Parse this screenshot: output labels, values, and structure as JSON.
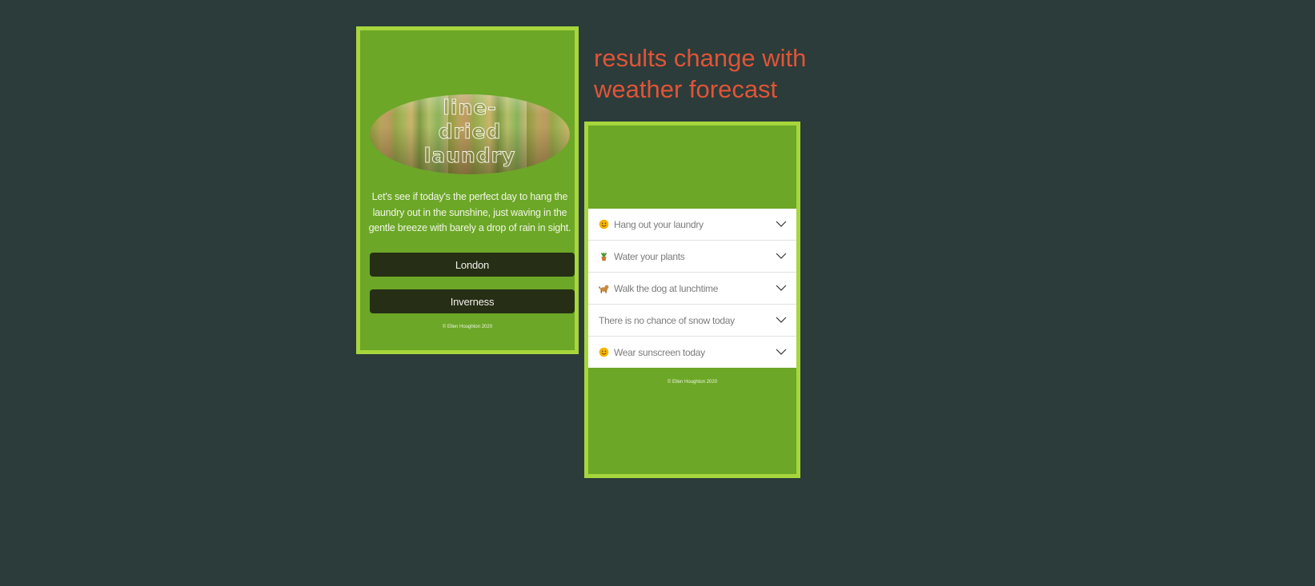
{
  "left_card": {
    "logo_text": "line-\ndried\nlaundry",
    "intro": "Let's see if today's the perfect day to hang the laundry out in the sunshine, just waving in the gentle breeze with barely a drop of rain in sight.",
    "cities": [
      "London",
      "Inverness"
    ],
    "footer": "© Ellen Houghton 2020"
  },
  "annotation": "results change with weather forecast",
  "right_card": {
    "results": [
      {
        "icon": "smiling-sun-icon",
        "label": "Hang out your laundry"
      },
      {
        "icon": "potted-plant-icon",
        "label": "Water your plants"
      },
      {
        "icon": "dog-icon",
        "label": "Walk the dog at lunchtime"
      },
      {
        "icon": "",
        "label": "There is no chance of snow today"
      },
      {
        "icon": "smiling-sun-icon",
        "label": "Wear sunscreen today"
      }
    ],
    "footer": "© Ellen Houghton 2020"
  },
  "colors": {
    "background": "#2b3c3a",
    "card": "#6ca727",
    "card_border": "#a7d63c",
    "button": "#262e15",
    "annotation": "#e15437"
  }
}
